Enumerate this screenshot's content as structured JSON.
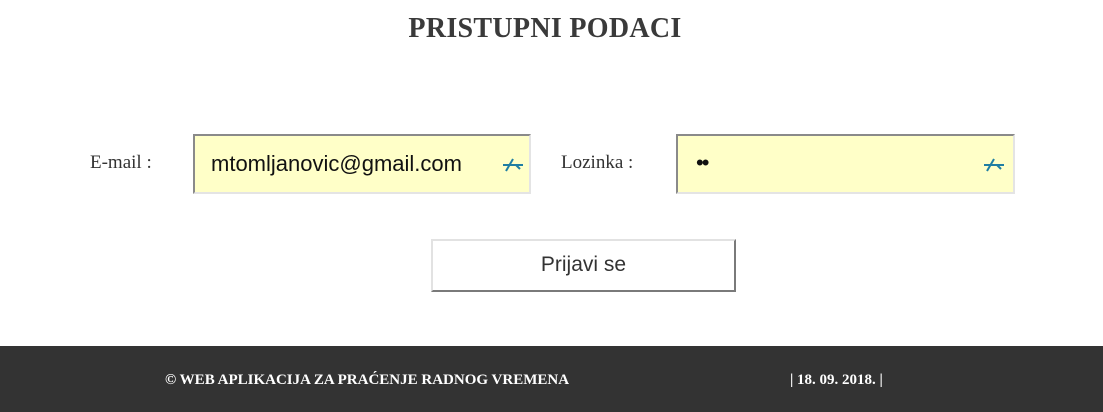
{
  "header": {
    "title": "PRISTUPNI PODACI"
  },
  "form": {
    "email_label": "E-mail :",
    "email_value": "mtomljanovic@gmail.com",
    "password_label": "Lozinka :",
    "password_mask": "••",
    "login_button_label": "Prijavi se",
    "input_background": "#ffffc8",
    "autofill_icon": "key-icon"
  },
  "footer": {
    "copyright": "© WEB APLIKACIJA ZA PRAĆENJE RADNOG VREMENA",
    "date": "| 18. 09. 2018. |",
    "background": "#333333"
  }
}
